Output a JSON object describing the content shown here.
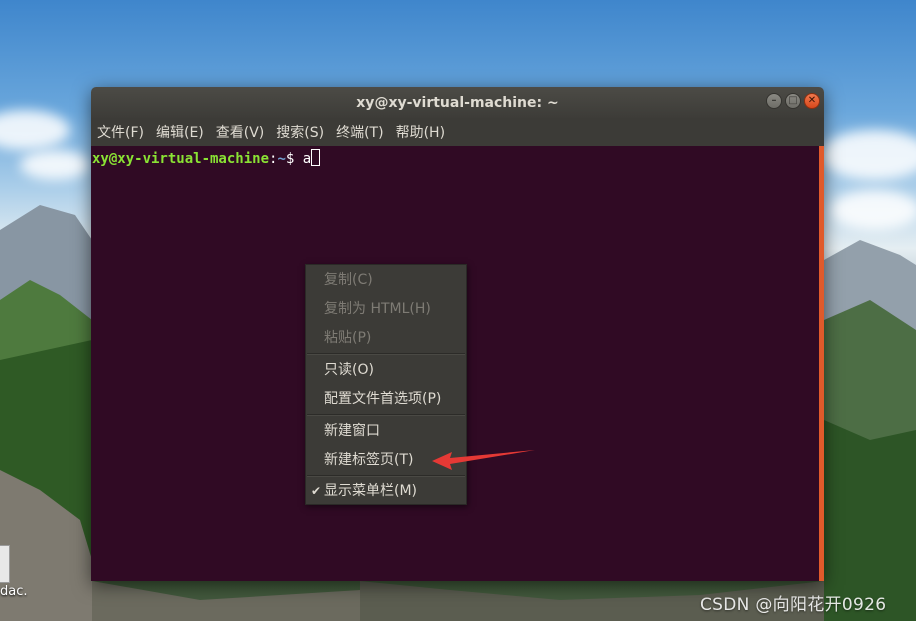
{
  "window": {
    "title": "xy@xy-virtual-machine: ~"
  },
  "menubar": {
    "items": [
      "文件(F)",
      "编辑(E)",
      "查看(V)",
      "搜索(S)",
      "终端(T)",
      "帮助(H)"
    ]
  },
  "terminal": {
    "user_host": "xy@xy-virtual-machine",
    "separator": ":",
    "path": "~",
    "dollar": "$ ",
    "command": "a"
  },
  "context_menu": {
    "copy": "复制(C)",
    "copy_html": "复制为 HTML(H)",
    "paste": "粘贴(P)",
    "read_only": "只读(O)",
    "profile_prefs": "配置文件首选项(P)",
    "new_window": "新建窗口",
    "new_tab": "新建标签页(T)",
    "show_menubar": "显示菜单栏(M)"
  },
  "desktop": {
    "partial_label": "dac.",
    "watermark": "CSDN @向阳花开0926"
  },
  "colors": {
    "terminal_bg": "#300a24",
    "prompt_user": "#8ae234",
    "prompt_path": "#729fcf",
    "menu_bg": "#3c3b37",
    "close_button": "#e0562a",
    "annotation_arrow": "#e53935"
  }
}
